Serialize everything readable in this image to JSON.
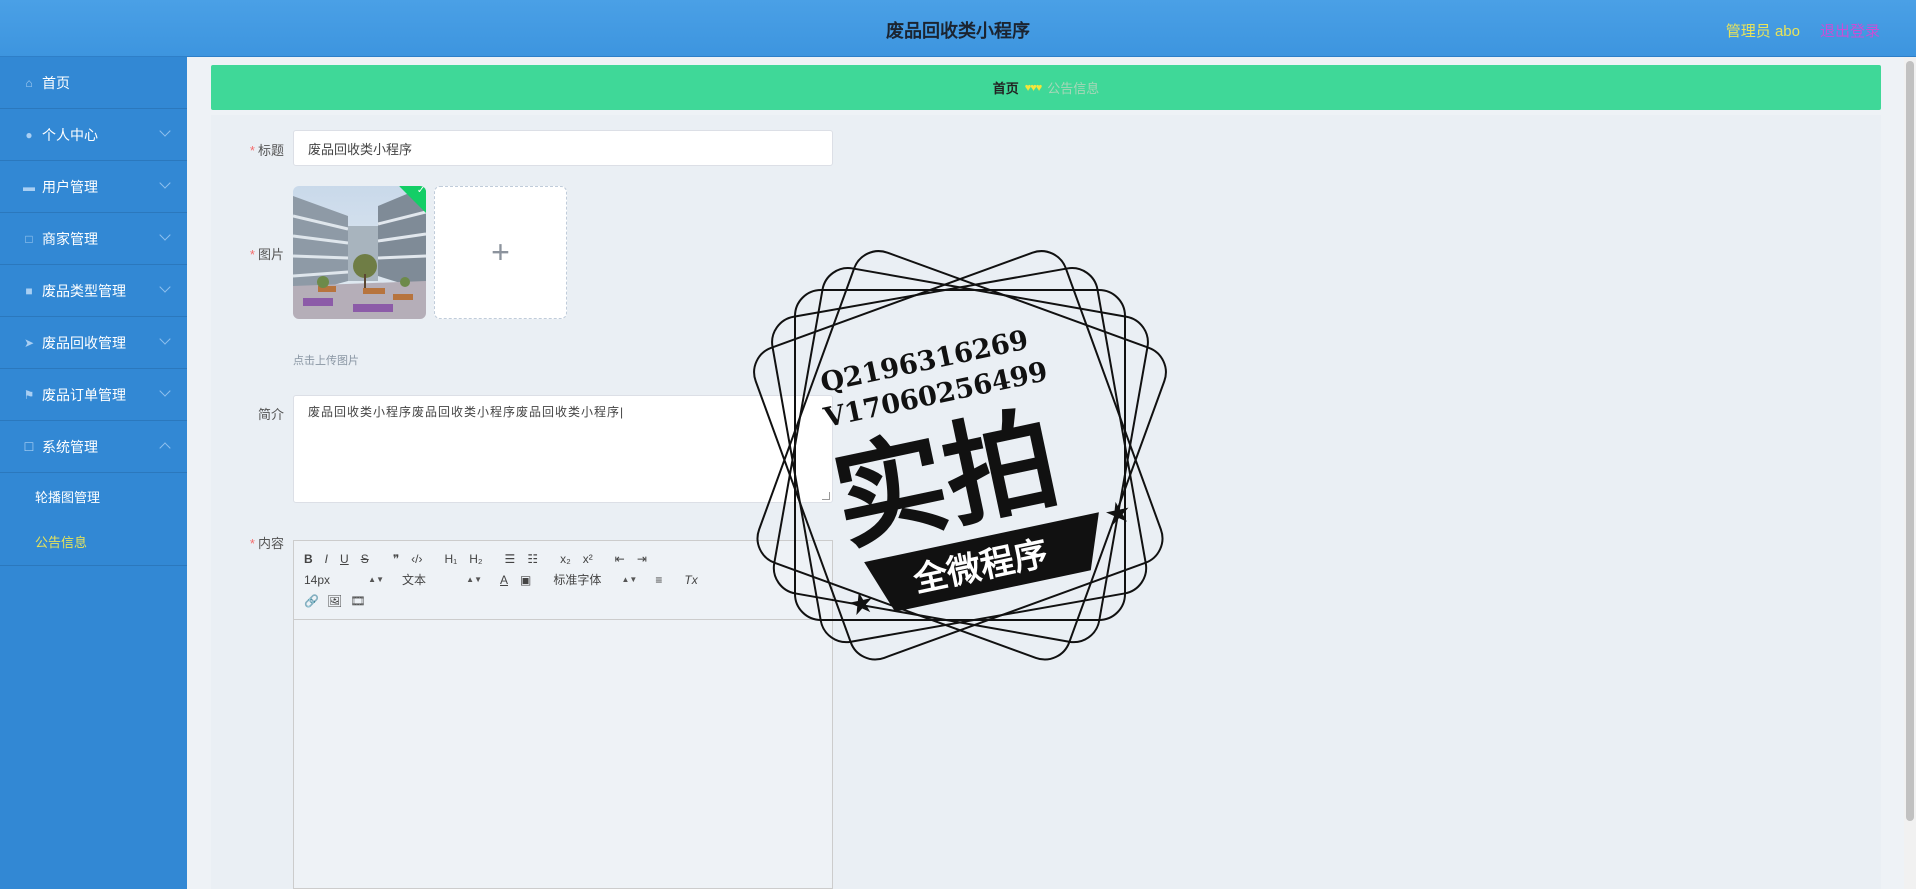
{
  "header": {
    "title": "废品回收类小程序",
    "user": "管理员 abo",
    "logout": "退出登录"
  },
  "sidebar": {
    "items": [
      {
        "label": "首页",
        "icon": "home-icon"
      },
      {
        "label": "个人中心",
        "icon": "user-icon"
      },
      {
        "label": "用户管理",
        "icon": "chat-icon"
      },
      {
        "label": "商家管理",
        "icon": "doc-icon"
      },
      {
        "label": "废品类型管理",
        "icon": "bag-icon"
      },
      {
        "label": "废品回收管理",
        "icon": "send-icon"
      },
      {
        "label": "废品订单管理",
        "icon": "flag-icon"
      },
      {
        "label": "系统管理",
        "icon": "box-icon"
      }
    ],
    "subitems": [
      {
        "label": "轮播图管理"
      },
      {
        "label": "公告信息"
      }
    ]
  },
  "breadcrumb": {
    "home": "首页",
    "separator": "♥♥♥",
    "current": "公告信息"
  },
  "form": {
    "title_label": "标题",
    "title_value": "废品回收类小程序",
    "image_label": "图片",
    "upload_tip": "点击上传图片",
    "intro_label": "简介",
    "intro_value": "废品回收类小程序废品回收类小程序废品回收类小程序",
    "content_label": "内容",
    "required_mark": "*"
  },
  "editor": {
    "buttons_row1": [
      "B",
      "I",
      "U",
      "S",
      "❞",
      "‹/›",
      "H₁",
      "H₂",
      "☰",
      "☷",
      "x₂",
      "x²",
      "⇤",
      "⇥"
    ],
    "size_value": "14px",
    "format_value": "文本",
    "font_value": "标准字体",
    "buttons_row3": [
      "🔗",
      "🖼",
      "🎞"
    ]
  },
  "stamp": {
    "line1": "Q2196316269",
    "line2": "V17060256499",
    "big": "实拍",
    "banner": "全微程序"
  },
  "colors": {
    "header": "#4aa0e6",
    "sidebar": "#3288d4",
    "breadcrumb": "#3fd898",
    "accent_yellow": "#e8e35a",
    "logout": "#c84fd6"
  }
}
